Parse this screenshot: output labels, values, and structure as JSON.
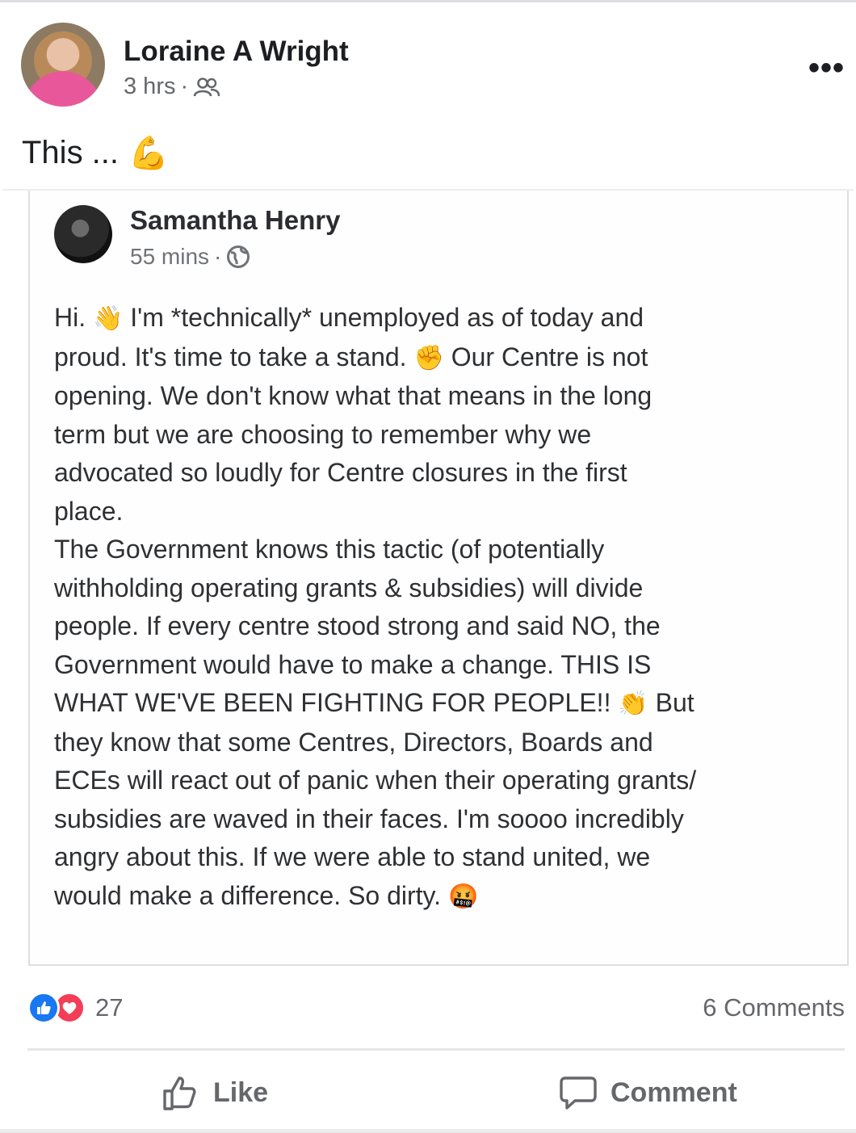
{
  "post": {
    "author": "Loraine A Wright",
    "time": "3 hrs",
    "separator": "·",
    "caption": "This ...",
    "caption_emoji": "💪",
    "more_label": "•••"
  },
  "shared": {
    "author": "Samantha Henry",
    "time": "55 mins",
    "separator": "·",
    "lines": [
      {
        "text": "Hi. ",
        "emoji": "👋",
        "after": " I'm *technically* unemployed as of today and"
      },
      {
        "text": "proud. It's time to take a stand. ",
        "emoji": "✊",
        "after": " Our Centre is not"
      },
      {
        "text": "opening. We don't know what that means in the long"
      },
      {
        "text": "term but we are choosing to remember why we"
      },
      {
        "text": "advocated so loudly for Centre closures in the first"
      },
      {
        "text": "place."
      },
      {
        "text": "The Government knows this tactic (of potentially"
      },
      {
        "text": "withholding operating grants & subsidies) will divide"
      },
      {
        "text": "people. If every centre stood strong and said NO, the"
      },
      {
        "text": "Government would have to make a change. THIS IS"
      },
      {
        "text": "WHAT WE'VE BEEN FIGHTING FOR PEOPLE!! ",
        "emoji": "👏",
        "after": " But"
      },
      {
        "text": "they know that some Centres, Directors, Boards and"
      },
      {
        "text": "ECEs will react out of panic when their operating grants/"
      },
      {
        "text": "subsidies are waved in their faces. I'm soooo incredibly"
      },
      {
        "text": "angry about this. If we were able to stand united, we"
      },
      {
        "text": "would make a difference. So dirty. ",
        "emoji": "🤬"
      }
    ]
  },
  "reactions": {
    "count": "27",
    "comments": "6 Comments"
  },
  "actions": {
    "like": "Like",
    "comment": "Comment"
  },
  "icons": {
    "like_color": "#1877f2",
    "love_color": "#f33e58"
  }
}
